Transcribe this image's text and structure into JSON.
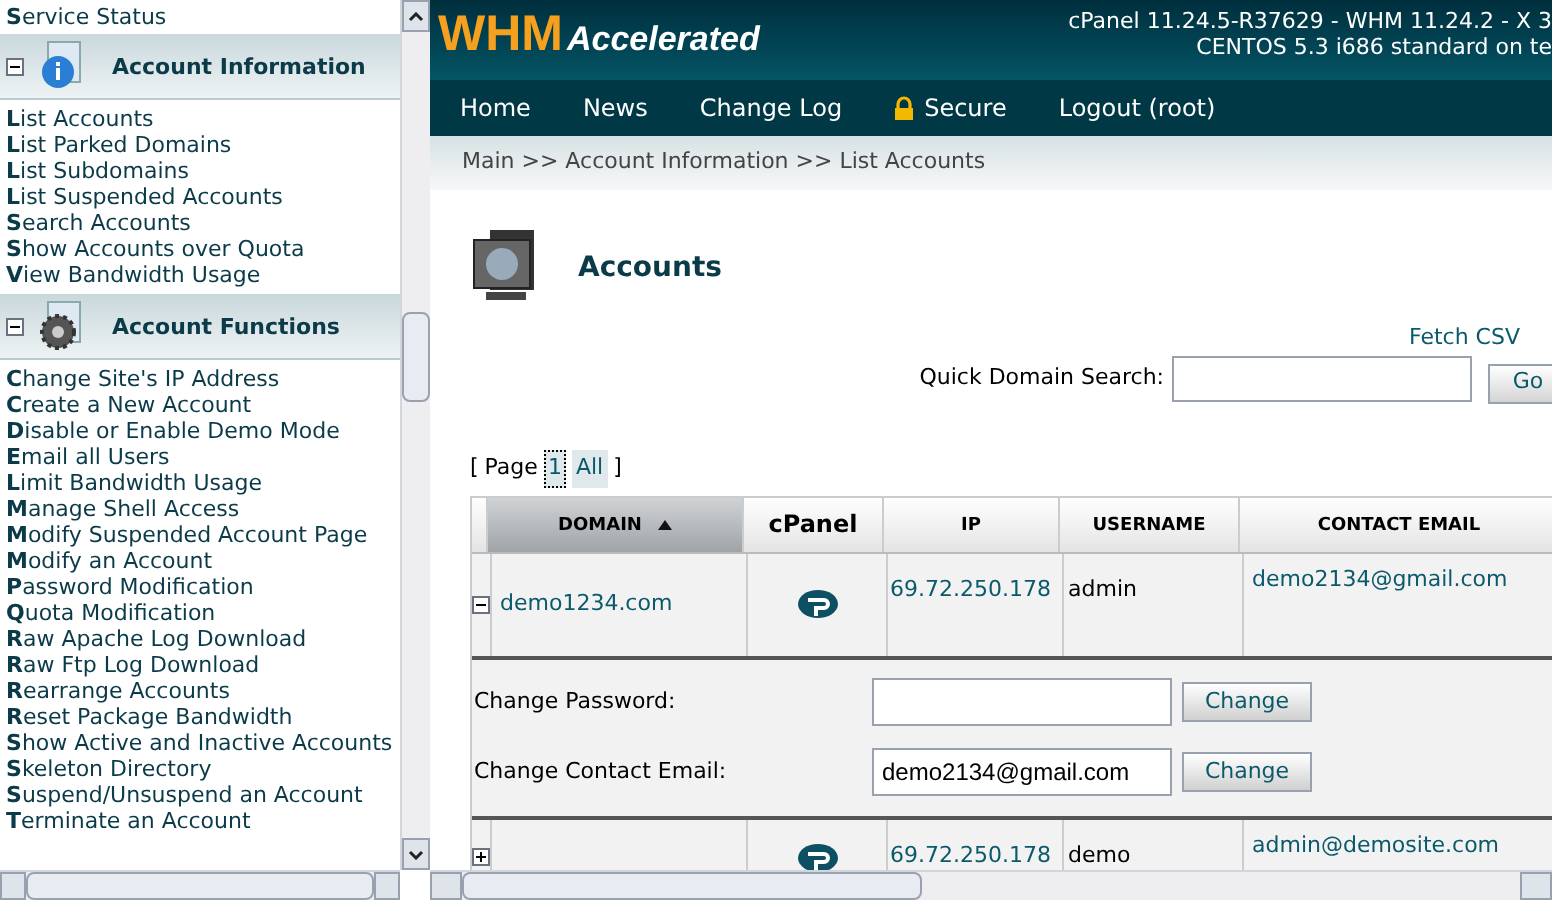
{
  "sidebar": {
    "top_item": "**S**ervice Status",
    "sections": [
      {
        "title": "Account Information",
        "expanded": true,
        "kind": "info",
        "items": [
          "**L**ist Accounts",
          "**L**ist Parked Domains",
          "**L**ist Subdomains",
          "**L**ist Suspended Accounts",
          "**S**earch Accounts",
          "**S**how Accounts over Quota",
          "**V**iew Bandwidth Usage"
        ]
      },
      {
        "title": "Account Functions",
        "expanded": true,
        "kind": "gear",
        "items": [
          "**C**hange Site's IP Address",
          "**C**reate a New Account",
          "**D**isable or Enable Demo Mode",
          "**E**mail all Users",
          "**L**imit Bandwidth Usage",
          "**M**anage Shell Access",
          "**M**odify Suspended Account Page",
          "**M**odify an Account",
          "**P**assword Modification",
          "**Q**uota Modification",
          "**R**aw Apache Log Download",
          "**R**aw Ftp Log Download",
          "**R**earrange Accounts",
          "**R**eset Package Bandwidth",
          "**S**how Active and Inactive Accounts",
          "**S**keleton Directory",
          "**S**uspend/Unsuspend an Account",
          "**T**erminate an Account"
        ]
      }
    ]
  },
  "header": {
    "logo_main": "WHM",
    "logo_sub": "Accelerated",
    "version_lines": [
      "cPanel 11.24.5-R37629 - WHM 11.24.2 - X 3",
      "CENTOS 5.3 i686 standard on te"
    ]
  },
  "nav": [
    {
      "label": "Home",
      "lock": false
    },
    {
      "label": "News",
      "lock": false
    },
    {
      "label": "Change Log",
      "lock": false
    },
    {
      "label": "Secure",
      "lock": true
    },
    {
      "label": "Logout (root)",
      "lock": false
    }
  ],
  "breadcrumb": "Main >> Account Information >> List Accounts",
  "page_title": "Accounts",
  "fetch_csv": "Fetch CSV",
  "quick_search": {
    "label": "Quick Domain Search:",
    "button": "Go"
  },
  "pager": {
    "open": "[",
    "label": "Page",
    "pages": [
      {
        "label": "1",
        "selected": true
      },
      {
        "label": "All",
        "selected": false
      }
    ],
    "close": "]"
  },
  "table": {
    "columns": [
      {
        "label": "Domain",
        "sorted": true
      },
      {
        "label": "cPanel",
        "sorted": false
      },
      {
        "label": "Ip",
        "sorted": false
      },
      {
        "label": "Username",
        "sorted": false
      },
      {
        "label": "Contact Email",
        "sorted": false
      }
    ],
    "rows": [
      {
        "expanded": true,
        "domain": "demo1234.com",
        "ip": "69.72.250.178",
        "username": "admin",
        "email": "demo2134@gmail.com",
        "details": [
          {
            "label": "Change Password:",
            "button": "Change"
          },
          {
            "label": "Change Contact Email:",
            "value": "demo2134@gmail.com",
            "button": "Change"
          }
        ]
      },
      {
        "expanded": false,
        "ip": "69.72.250.178",
        "username": "demo",
        "email": "admin@demosite.com"
      }
    ]
  }
}
